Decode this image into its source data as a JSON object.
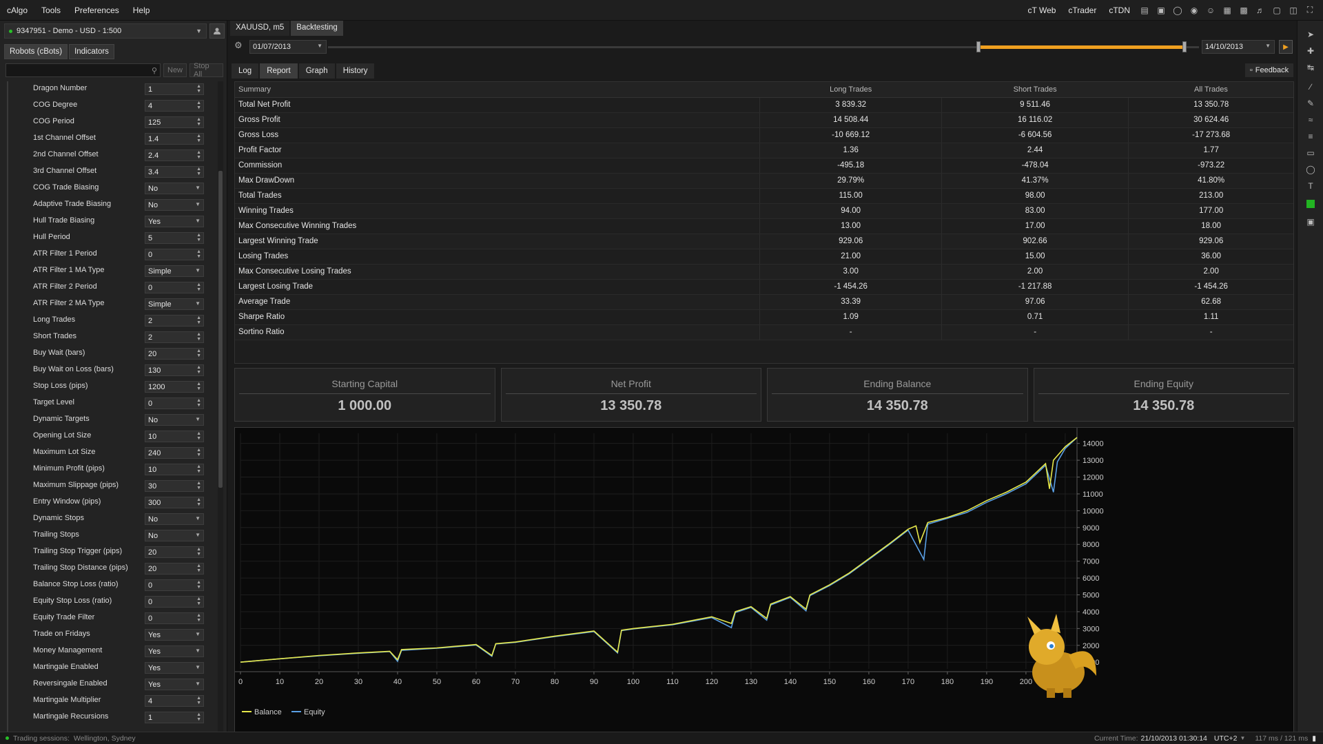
{
  "menu": [
    "cAlgo",
    "Tools",
    "Preferences",
    "Help"
  ],
  "top_links": [
    "cT Web",
    "cTrader",
    "cTDN"
  ],
  "account": "9347951 - Demo - USD - 1:500",
  "left_tabs": [
    "Robots (cBots)",
    "Indicators"
  ],
  "left_buttons": {
    "new": "New",
    "stop_all": "Stop All"
  },
  "params": [
    {
      "label": "Dragon Number",
      "value": "1",
      "kind": "num"
    },
    {
      "label": "COG Degree",
      "value": "4",
      "kind": "num"
    },
    {
      "label": "COG Period",
      "value": "125",
      "kind": "num"
    },
    {
      "label": "1st Channel Offset",
      "value": "1.4",
      "kind": "num"
    },
    {
      "label": "2nd Channel Offset",
      "value": "2.4",
      "kind": "num"
    },
    {
      "label": "3rd Channel Offset",
      "value": "3.4",
      "kind": "num"
    },
    {
      "label": "COG Trade Biasing",
      "value": "No",
      "kind": "dd"
    },
    {
      "label": "Adaptive Trade Biasing",
      "value": "No",
      "kind": "dd"
    },
    {
      "label": "Hull Trade Biasing",
      "value": "Yes",
      "kind": "dd"
    },
    {
      "label": "Hull Period",
      "value": "5",
      "kind": "num"
    },
    {
      "label": "ATR Filter 1 Period",
      "value": "0",
      "kind": "num"
    },
    {
      "label": "ATR Filter 1 MA Type",
      "value": "Simple",
      "kind": "dd"
    },
    {
      "label": "ATR Filter 2 Period",
      "value": "0",
      "kind": "num"
    },
    {
      "label": "ATR Filter 2 MA Type",
      "value": "Simple",
      "kind": "dd"
    },
    {
      "label": "Long Trades",
      "value": "2",
      "kind": "num"
    },
    {
      "label": "Short Trades",
      "value": "2",
      "kind": "num"
    },
    {
      "label": "Buy Wait (bars)",
      "value": "20",
      "kind": "num"
    },
    {
      "label": "Buy Wait on Loss (bars)",
      "value": "130",
      "kind": "num"
    },
    {
      "label": "Stop Loss (pips)",
      "value": "1200",
      "kind": "num"
    },
    {
      "label": "Target Level",
      "value": "0",
      "kind": "num"
    },
    {
      "label": "Dynamic Targets",
      "value": "No",
      "kind": "dd"
    },
    {
      "label": "Opening Lot Size",
      "value": "10",
      "kind": "num"
    },
    {
      "label": "Maximum Lot Size",
      "value": "240",
      "kind": "num"
    },
    {
      "label": "Minimum Profit (pips)",
      "value": "10",
      "kind": "num"
    },
    {
      "label": "Maximum Slippage (pips)",
      "value": "30",
      "kind": "num"
    },
    {
      "label": "Entry Window (pips)",
      "value": "300",
      "kind": "num"
    },
    {
      "label": "Dynamic Stops",
      "value": "No",
      "kind": "dd"
    },
    {
      "label": "Trailing Stops",
      "value": "No",
      "kind": "dd"
    },
    {
      "label": "Trailing Stop Trigger (pips)",
      "value": "20",
      "kind": "num"
    },
    {
      "label": "Trailing Stop Distance (pips)",
      "value": "20",
      "kind": "num"
    },
    {
      "label": "Balance Stop Loss (ratio)",
      "value": "0",
      "kind": "num"
    },
    {
      "label": "Equity Stop Loss (ratio)",
      "value": "0",
      "kind": "num"
    },
    {
      "label": "Equity Trade Filter",
      "value": "0",
      "kind": "num"
    },
    {
      "label": "Trade on Fridays",
      "value": "Yes",
      "kind": "dd"
    },
    {
      "label": "Money Management",
      "value": "Yes",
      "kind": "dd"
    },
    {
      "label": "Martingale Enabled",
      "value": "Yes",
      "kind": "dd"
    },
    {
      "label": "Reversingale Enabled",
      "value": "Yes",
      "kind": "dd"
    },
    {
      "label": "Martingale Multiplier",
      "value": "4",
      "kind": "num"
    },
    {
      "label": "Martingale Recursions",
      "value": "1",
      "kind": "num"
    }
  ],
  "top_tabs": [
    "XAUUSD, m5",
    "Backtesting"
  ],
  "backtest": {
    "start": "01/07/2013",
    "end": "14/10/2013",
    "progress": 0.76
  },
  "sub_tabs": [
    "Log",
    "Report",
    "Graph",
    "History"
  ],
  "feedback": "Feedback",
  "report": {
    "headers": [
      "Summary",
      "Long Trades",
      "Short Trades",
      "All Trades"
    ],
    "rows": [
      [
        "Total Net Profit",
        "3 839.32",
        "9 511.46",
        "13 350.78"
      ],
      [
        "Gross Profit",
        "14 508.44",
        "16 116.02",
        "30 624.46"
      ],
      [
        "Gross Loss",
        "-10 669.12",
        "-6 604.56",
        "-17 273.68"
      ],
      [
        "Profit Factor",
        "1.36",
        "2.44",
        "1.77"
      ],
      [
        "Commission",
        "-495.18",
        "-478.04",
        "-973.22"
      ],
      [
        "Max DrawDown",
        "29.79%",
        "41.37%",
        "41.80%"
      ],
      [
        "Total Trades",
        "115.00",
        "98.00",
        "213.00"
      ],
      [
        "Winning Trades",
        "94.00",
        "83.00",
        "177.00"
      ],
      [
        "Max Consecutive Winning Trades",
        "13.00",
        "17.00",
        "18.00"
      ],
      [
        "Largest Winning Trade",
        "929.06",
        "902.66",
        "929.06"
      ],
      [
        "Losing Trades",
        "21.00",
        "15.00",
        "36.00"
      ],
      [
        "Max Consecutive Losing Trades",
        "3.00",
        "2.00",
        "2.00"
      ],
      [
        "Largest Losing Trade",
        "-1 454.26",
        "-1 217.88",
        "-1 454.26"
      ],
      [
        "Average Trade",
        "33.39",
        "97.06",
        "62.68"
      ],
      [
        "Sharpe Ratio",
        "1.09",
        "0.71",
        "1.11"
      ],
      [
        "Sortino Ratio",
        "-",
        "-",
        "-"
      ]
    ]
  },
  "summary": [
    {
      "label": "Starting Capital",
      "value": "1 000.00"
    },
    {
      "label": "Net Profit",
      "value": "13 350.78"
    },
    {
      "label": "Ending Balance",
      "value": "14 350.78"
    },
    {
      "label": "Ending Equity",
      "value": "14 350.78"
    }
  ],
  "chart_data": {
    "type": "line",
    "xlim": [
      0,
      213
    ],
    "ylim": [
      600,
      14600
    ],
    "xticks": [
      0,
      10,
      20,
      30,
      40,
      50,
      60,
      70,
      80,
      90,
      100,
      110,
      120,
      130,
      140,
      150,
      160,
      170,
      180,
      190,
      200,
      210
    ],
    "yticks": [
      1000,
      2000,
      3000,
      4000,
      5000,
      6000,
      7000,
      8000,
      9000,
      10000,
      11000,
      12000,
      13000,
      14000
    ],
    "legend": "bottom-left",
    "series": [
      {
        "name": "Balance",
        "color": "#e6e84a",
        "x": [
          0,
          10,
          20,
          30,
          38,
          40,
          41,
          50,
          60,
          64,
          65,
          70,
          80,
          90,
          96,
          97,
          100,
          110,
          120,
          125,
          126,
          130,
          134,
          135,
          140,
          144,
          145,
          150,
          155,
          160,
          165,
          170,
          172,
          173,
          175,
          180,
          185,
          190,
          195,
          200,
          205,
          206,
          207,
          210,
          213
        ],
        "values": [
          1000,
          1200,
          1400,
          1550,
          1650,
          1150,
          1750,
          1850,
          2050,
          1400,
          2100,
          2200,
          2550,
          2850,
          1600,
          2900,
          3000,
          3250,
          3700,
          3300,
          4000,
          4300,
          3600,
          4450,
          4900,
          4150,
          5000,
          5600,
          6300,
          7150,
          8000,
          8900,
          9100,
          8100,
          9300,
          9600,
          10000,
          10600,
          11100,
          11700,
          12800,
          11300,
          13000,
          13800,
          14350
        ]
      },
      {
        "name": "Equity",
        "color": "#5aa0e6",
        "x": [
          0,
          10,
          20,
          30,
          38,
          40,
          41,
          50,
          60,
          64,
          65,
          70,
          80,
          90,
          96,
          97,
          100,
          110,
          120,
          125,
          126,
          130,
          134,
          135,
          140,
          144,
          145,
          150,
          155,
          160,
          165,
          170,
          174,
          175,
          180,
          185,
          190,
          195,
          200,
          205,
          207,
          208,
          210,
          213
        ],
        "values": [
          1000,
          1200,
          1380,
          1530,
          1630,
          1050,
          1700,
          1830,
          2020,
          1350,
          2080,
          2180,
          2520,
          2820,
          1550,
          2870,
          2980,
          3220,
          3650,
          3050,
          3950,
          4250,
          3500,
          4400,
          4850,
          4050,
          4950,
          5550,
          6250,
          7100,
          7950,
          8850,
          7100,
          9200,
          9550,
          9900,
          10500,
          11000,
          11600,
          12700,
          11100,
          12900,
          13700,
          14350
        ]
      }
    ]
  },
  "status": {
    "sessions_label": "Trading sessions:",
    "sessions": "Wellington, Sydney",
    "time_label": "Current Time:",
    "time": "21/10/2013 01:30:14",
    "tz": "UTC+2",
    "latency": "117 ms / 121 ms"
  }
}
